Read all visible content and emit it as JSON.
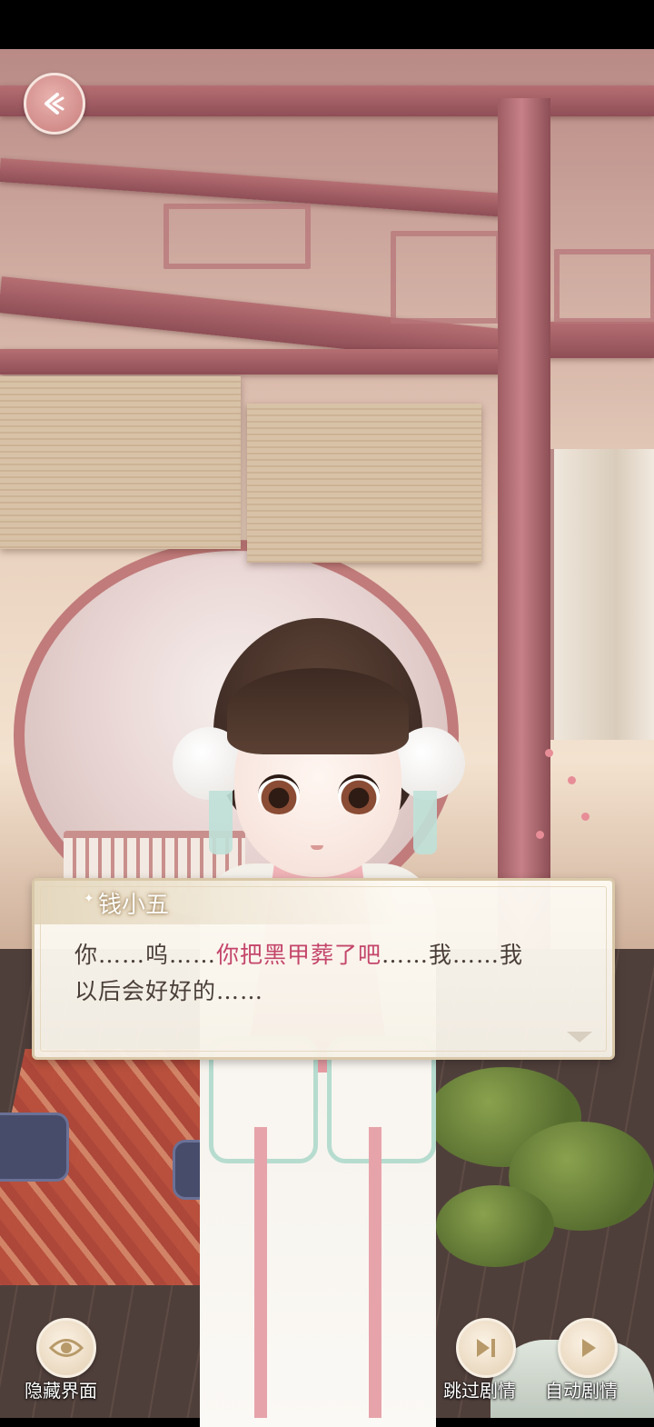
{
  "dialog": {
    "speaker": "钱小五",
    "line1_a": "你……呜……",
    "line1_highlight": "你把黑甲葬了吧",
    "line1_b": "……我……我",
    "line2": "以后会好好的……"
  },
  "controls": {
    "hide_ui": "隐藏界面",
    "skip_story": "跳过剧情",
    "auto_story": "自动剧情"
  },
  "icons": {
    "back": "back-arrow-icon",
    "hide": "eye-icon",
    "skip": "skip-icon",
    "auto": "play-icon",
    "next": "chevron-down-icon"
  },
  "colors": {
    "highlight": "#c4456a",
    "dialog_bg": "#fdfaf3",
    "button": "#c87e7c"
  }
}
